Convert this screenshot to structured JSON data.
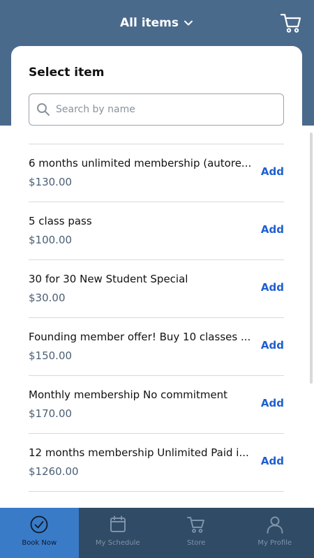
{
  "header": {
    "title": "All items",
    "title_icon": "chevron-down-icon",
    "cart_icon": "shopping-cart-icon"
  },
  "card": {
    "title": "Select item"
  },
  "search": {
    "placeholder": "Search by name",
    "value": ""
  },
  "items": [
    {
      "name": "6 months unlimited membership (autore...",
      "price": "$130.00",
      "action": "Add"
    },
    {
      "name": "5 class pass",
      "price": "$100.00",
      "action": "Add"
    },
    {
      "name": "30 for 30 New Student Special",
      "price": "$30.00",
      "action": "Add"
    },
    {
      "name": "Founding member offer! Buy 10 classes ...",
      "price": "$150.00",
      "action": "Add"
    },
    {
      "name": "Monthly membership No commitment",
      "price": "$170.00",
      "action": "Add"
    },
    {
      "name": "12 months membership Unlimited Paid i...",
      "price": "$1260.00",
      "action": "Add"
    }
  ],
  "tabbar": {
    "tabs": [
      {
        "label": "Book Now",
        "icon": "check-circle-icon",
        "active": true
      },
      {
        "label": "My Schedule",
        "icon": "calendar-icon",
        "active": false
      },
      {
        "label": "Store",
        "icon": "shopping-cart-icon",
        "active": false
      },
      {
        "label": "My Profile",
        "icon": "person-icon",
        "active": false
      }
    ]
  },
  "colors": {
    "header_bg": "#4a6a8c",
    "tabbar_bg": "#2f4b66",
    "tab_active_bg": "#3a7bc8",
    "accent": "#1f5fd1",
    "price": "#4a5f74"
  }
}
